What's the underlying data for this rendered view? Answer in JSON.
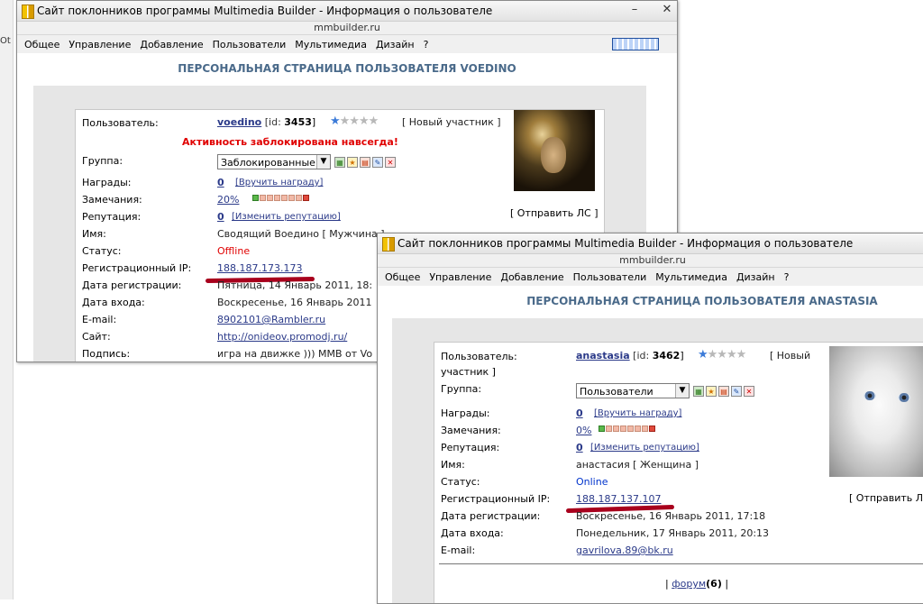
{
  "background": {
    "menu_fragment": "Ot"
  },
  "window1": {
    "title": "Сайт поклонников программы Multimedia Builder - Информация о пользователе",
    "url": "mmbuilder.ru",
    "menu": [
      "Общее",
      "Управление",
      "Добавление",
      "Пользователи",
      "Мультимедиа",
      "Дизайн",
      "?"
    ],
    "page_title": "ПЕРСОНАЛЬНАЯ СТРАНИЦА ПОЛЬЗОВАТЕЛЯ VOEDINO",
    "user": {
      "label": "Пользователь:",
      "name": "voedino",
      "id_prefix": "[id:",
      "id": "3453",
      "id_suffix": "]",
      "rank": "[ Новый участник ]",
      "blocked_notice": "Активность заблокирована навсегда!",
      "group_label": "Группа:",
      "group_value": "Заблокированные",
      "awards_label": "Награды:",
      "awards_value": "0",
      "awards_action": "[Вручить награду]",
      "warnings_label": "Замечания:",
      "warnings_value": "20%",
      "reputation_label": "Репутация:",
      "reputation_value": "0",
      "reputation_action": "[Изменить репутацию]",
      "send_pm": "[ Отправить ЛС ]",
      "name_label": "Имя:",
      "name_value": "Сводящий Воедино [ Мужчина ]",
      "status_label": "Статус:",
      "status_value": "Offline",
      "ip_label": "Регистрационный IP:",
      "ip_value": "188.187.173.173",
      "regdate_label": "Дата регистрации:",
      "regdate_value": "Пятница, 14 Январь 2011, 18:",
      "login_label": "Дата входа:",
      "login_value": "Воскресенье, 16 Январь 2011",
      "email_label": "E-mail:",
      "email_value": "8902101@Rambler.ru",
      "site_label": "Сайт:",
      "site_value": "http://onideov.promodj.ru/",
      "sign_label": "Подпись:",
      "sign_value": "игра на движке ))) MMB от Vo"
    }
  },
  "window2": {
    "title": "Сайт поклонников программы Multimedia Builder - Информация о пользователе",
    "url": "mmbuilder.ru",
    "menu": [
      "Общее",
      "Управление",
      "Добавление",
      "Пользователи",
      "Мультимедиа",
      "Дизайн",
      "?"
    ],
    "page_title": "ПЕРСОНАЛЬНАЯ СТРАНИЦА ПОЛЬЗОВАТЕЛЯ ANASTASIA",
    "user": {
      "label": "Пользователь:",
      "name": "anastasia",
      "id_prefix": "[id:",
      "id": "3462",
      "id_suffix": "]",
      "rank_line1": "[ Новый",
      "rank_line2": "участник ]",
      "group_label": "Группа:",
      "group_value": "Пользователи",
      "awards_label": "Награды:",
      "awards_value": "0",
      "awards_action": "[Вручить награду]",
      "warnings_label": "Замечания:",
      "warnings_value": "0%",
      "reputation_label": "Репутация:",
      "reputation_value": "0",
      "reputation_action": "[Изменить репутацию]",
      "send_pm": "[ Отправить Л",
      "name_label": "Имя:",
      "name_value": "анастасия [ Женщина ]",
      "status_label": "Статус:",
      "status_value": "Online",
      "ip_label": "Регистрационный IP:",
      "ip_value": "188.187.137.107",
      "regdate_label": "Дата регистрации:",
      "regdate_value": "Воскресенье, 16 Январь 2011, 17:18",
      "login_label": "Дата входа:",
      "login_value": "Понедельник, 17 Январь 2011, 20:13",
      "email_label": "E-mail:",
      "email_value": "gavrilova.89@bk.ru",
      "forum_prefix": "|",
      "forum_link": "форум",
      "forum_count": "(6)",
      "forum_suffix": "|"
    }
  },
  "colors": {
    "accent": "#2b3a89",
    "blocked": "#e00000",
    "offline": "#e00000",
    "online": "#0033cc",
    "highlight_line": "#a8001d"
  }
}
